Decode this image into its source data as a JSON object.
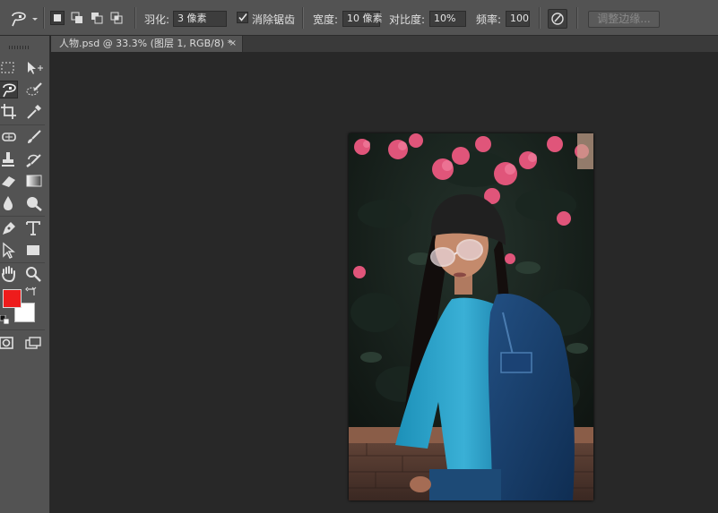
{
  "options_bar": {
    "feather_label": "羽化:",
    "feather_value": "3 像素",
    "antialias_label": "消除锯齿",
    "antialias_checked": true,
    "width_label": "宽度:",
    "width_value": "10 像素",
    "contrast_label": "对比度:",
    "contrast_value": "10%",
    "frequency_label": "频率:",
    "frequency_value": "100",
    "refine_edge_label": "调整边缘..."
  },
  "document_tab": {
    "title": "人物.psd @ 33.3% (图层 1, RGB/8) *",
    "close": "×"
  },
  "colors": {
    "foreground": "#ee1c1c",
    "background": "#ffffff"
  },
  "tools": [
    "rectangular-marquee-icon",
    "move-icon",
    "magnetic-lasso-icon",
    "quick-selection-icon",
    "crop-icon",
    "eyedropper-icon",
    "spot-healing-icon",
    "brush-icon",
    "clone-stamp-icon",
    "history-brush-icon",
    "eraser-icon",
    "gradient-icon",
    "blur-icon",
    "dodge-icon",
    "pen-icon",
    "type-icon",
    "path-selection-icon",
    "rectangle-shape-icon",
    "hand-icon",
    "zoom-icon",
    "quick-mask-icon",
    "screen-mode-icon"
  ]
}
